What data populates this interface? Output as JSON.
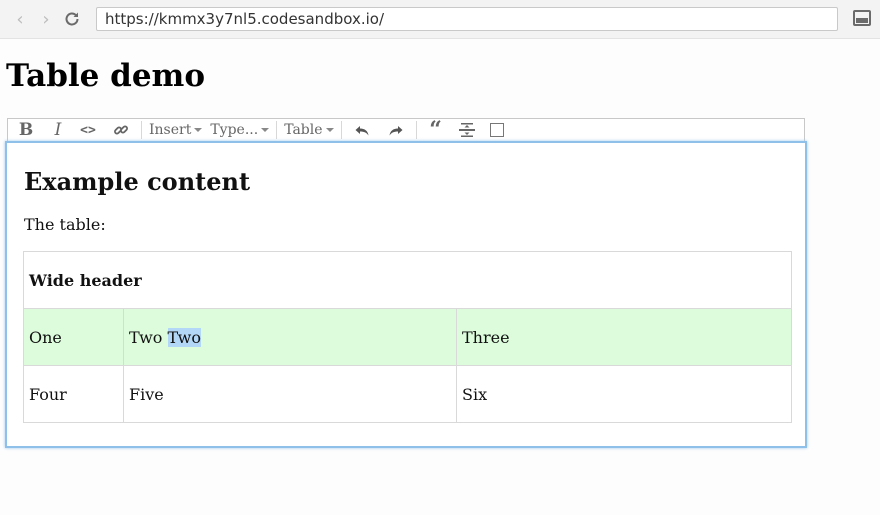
{
  "browser": {
    "url": "https://kmmx3y7nl5.codesandbox.io/",
    "icons": [
      "back-arrow-icon",
      "forward-arrow-icon",
      "reload-icon",
      "cast-icon"
    ]
  },
  "page": {
    "title": "Table demo"
  },
  "menubar": {
    "bold": "B",
    "italic": "I",
    "code": "<>",
    "link_icon": "link-icon",
    "insert": "Insert",
    "type": "Type...",
    "table": "Table",
    "undo_icon": "undo-icon",
    "redo_icon": "redo-icon",
    "quote": "“",
    "hr_icon": "horizontal-rule-icon",
    "select_parent_icon": "select-parent-node-icon"
  },
  "editor": {
    "heading": "Example content",
    "paragraph": "The table:",
    "table": {
      "header": "Wide header",
      "rows": [
        {
          "c1": "One",
          "c2_before": "Two ",
          "c2_selected": "Two",
          "c3": "Three"
        },
        {
          "c1": "Four",
          "c2": "Five",
          "c3": "Six"
        }
      ]
    },
    "colors": {
      "focus_border": "#8ec0ea",
      "row_highlight": "#dcfcdc",
      "selection": "#b3d7f7"
    }
  }
}
